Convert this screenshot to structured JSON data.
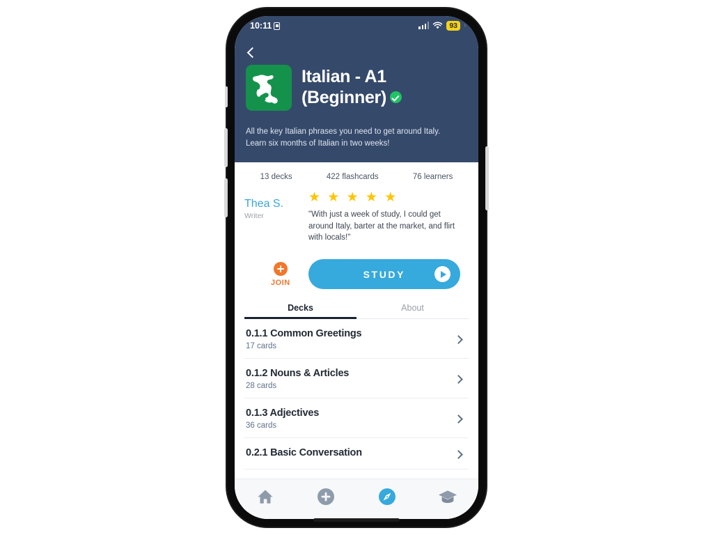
{
  "status_bar": {
    "time": "10:11",
    "lock_icon": "lock-portrait-icon",
    "signal_icon": "cellular-signal-icon",
    "wifi_icon": "wifi-icon",
    "battery_level": "93"
  },
  "header": {
    "back_icon": "back-chevron-icon",
    "flag_icon": "italy-map-icon",
    "flag_color": "#14924b",
    "title": "Italian - A1 (Beginner)",
    "verified_icon": "verified-check-icon",
    "verified_color": "#1fc464",
    "description": "All the key Italian phrases you need to get around Italy. Learn six months of Italian in two weeks!",
    "background_color": "#35496b"
  },
  "stats": [
    {
      "label": "13 decks"
    },
    {
      "label": "422 flashcards"
    },
    {
      "label": "76 learners"
    }
  ],
  "review": {
    "name": "Thea S.",
    "role": "Writer",
    "stars": "★ ★ ★ ★ ★",
    "rating": 5,
    "quote": "\"With just a week of study, I could get around Italy, barter at the market, and flirt with locals!\""
  },
  "actions": {
    "join_label": "JOIN",
    "join_icon": "plus-circle-icon",
    "join_color": "#f2762b",
    "study_label": "STUDY",
    "study_icon": "play-circle-icon",
    "study_color": "#36a9dd"
  },
  "tabs": [
    {
      "label": "Decks",
      "active": true
    },
    {
      "label": "About",
      "active": false
    }
  ],
  "decks": [
    {
      "title": "0.1.1 Common Greetings",
      "count": "17 cards"
    },
    {
      "title": "0.1.2 Nouns & Articles",
      "count": "28 cards"
    },
    {
      "title": "0.1.3 Adjectives",
      "count": "36 cards"
    },
    {
      "title": "0.2.1 Basic Conversation",
      "count": ""
    }
  ],
  "tabbar": [
    {
      "icon": "home-icon",
      "active": false
    },
    {
      "icon": "plus-circle-icon",
      "active": false
    },
    {
      "icon": "compass-icon",
      "active": true
    },
    {
      "icon": "graduation-cap-icon",
      "active": false
    }
  ]
}
